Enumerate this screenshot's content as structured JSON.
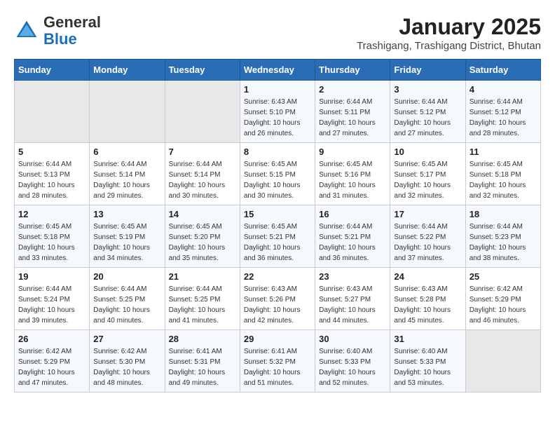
{
  "header": {
    "logo_general": "General",
    "logo_blue": "Blue",
    "month_title": "January 2025",
    "location": "Trashigang, Trashigang District, Bhutan"
  },
  "weekdays": [
    "Sunday",
    "Monday",
    "Tuesday",
    "Wednesday",
    "Thursday",
    "Friday",
    "Saturday"
  ],
  "weeks": [
    [
      {
        "day": "",
        "sunrise": "",
        "sunset": "",
        "daylight": "",
        "empty": true
      },
      {
        "day": "",
        "sunrise": "",
        "sunset": "",
        "daylight": "",
        "empty": true
      },
      {
        "day": "",
        "sunrise": "",
        "sunset": "",
        "daylight": "",
        "empty": true
      },
      {
        "day": "1",
        "sunrise": "Sunrise: 6:43 AM",
        "sunset": "Sunset: 5:10 PM",
        "daylight": "Daylight: 10 hours and 26 minutes.",
        "empty": false
      },
      {
        "day": "2",
        "sunrise": "Sunrise: 6:44 AM",
        "sunset": "Sunset: 5:11 PM",
        "daylight": "Daylight: 10 hours and 27 minutes.",
        "empty": false
      },
      {
        "day": "3",
        "sunrise": "Sunrise: 6:44 AM",
        "sunset": "Sunset: 5:12 PM",
        "daylight": "Daylight: 10 hours and 27 minutes.",
        "empty": false
      },
      {
        "day": "4",
        "sunrise": "Sunrise: 6:44 AM",
        "sunset": "Sunset: 5:12 PM",
        "daylight": "Daylight: 10 hours and 28 minutes.",
        "empty": false
      }
    ],
    [
      {
        "day": "5",
        "sunrise": "Sunrise: 6:44 AM",
        "sunset": "Sunset: 5:13 PM",
        "daylight": "Daylight: 10 hours and 28 minutes.",
        "empty": false
      },
      {
        "day": "6",
        "sunrise": "Sunrise: 6:44 AM",
        "sunset": "Sunset: 5:14 PM",
        "daylight": "Daylight: 10 hours and 29 minutes.",
        "empty": false
      },
      {
        "day": "7",
        "sunrise": "Sunrise: 6:44 AM",
        "sunset": "Sunset: 5:14 PM",
        "daylight": "Daylight: 10 hours and 30 minutes.",
        "empty": false
      },
      {
        "day": "8",
        "sunrise": "Sunrise: 6:45 AM",
        "sunset": "Sunset: 5:15 PM",
        "daylight": "Daylight: 10 hours and 30 minutes.",
        "empty": false
      },
      {
        "day": "9",
        "sunrise": "Sunrise: 6:45 AM",
        "sunset": "Sunset: 5:16 PM",
        "daylight": "Daylight: 10 hours and 31 minutes.",
        "empty": false
      },
      {
        "day": "10",
        "sunrise": "Sunrise: 6:45 AM",
        "sunset": "Sunset: 5:17 PM",
        "daylight": "Daylight: 10 hours and 32 minutes.",
        "empty": false
      },
      {
        "day": "11",
        "sunrise": "Sunrise: 6:45 AM",
        "sunset": "Sunset: 5:18 PM",
        "daylight": "Daylight: 10 hours and 32 minutes.",
        "empty": false
      }
    ],
    [
      {
        "day": "12",
        "sunrise": "Sunrise: 6:45 AM",
        "sunset": "Sunset: 5:18 PM",
        "daylight": "Daylight: 10 hours and 33 minutes.",
        "empty": false
      },
      {
        "day": "13",
        "sunrise": "Sunrise: 6:45 AM",
        "sunset": "Sunset: 5:19 PM",
        "daylight": "Daylight: 10 hours and 34 minutes.",
        "empty": false
      },
      {
        "day": "14",
        "sunrise": "Sunrise: 6:45 AM",
        "sunset": "Sunset: 5:20 PM",
        "daylight": "Daylight: 10 hours and 35 minutes.",
        "empty": false
      },
      {
        "day": "15",
        "sunrise": "Sunrise: 6:45 AM",
        "sunset": "Sunset: 5:21 PM",
        "daylight": "Daylight: 10 hours and 36 minutes.",
        "empty": false
      },
      {
        "day": "16",
        "sunrise": "Sunrise: 6:44 AM",
        "sunset": "Sunset: 5:21 PM",
        "daylight": "Daylight: 10 hours and 36 minutes.",
        "empty": false
      },
      {
        "day": "17",
        "sunrise": "Sunrise: 6:44 AM",
        "sunset": "Sunset: 5:22 PM",
        "daylight": "Daylight: 10 hours and 37 minutes.",
        "empty": false
      },
      {
        "day": "18",
        "sunrise": "Sunrise: 6:44 AM",
        "sunset": "Sunset: 5:23 PM",
        "daylight": "Daylight: 10 hours and 38 minutes.",
        "empty": false
      }
    ],
    [
      {
        "day": "19",
        "sunrise": "Sunrise: 6:44 AM",
        "sunset": "Sunset: 5:24 PM",
        "daylight": "Daylight: 10 hours and 39 minutes.",
        "empty": false
      },
      {
        "day": "20",
        "sunrise": "Sunrise: 6:44 AM",
        "sunset": "Sunset: 5:25 PM",
        "daylight": "Daylight: 10 hours and 40 minutes.",
        "empty": false
      },
      {
        "day": "21",
        "sunrise": "Sunrise: 6:44 AM",
        "sunset": "Sunset: 5:25 PM",
        "daylight": "Daylight: 10 hours and 41 minutes.",
        "empty": false
      },
      {
        "day": "22",
        "sunrise": "Sunrise: 6:43 AM",
        "sunset": "Sunset: 5:26 PM",
        "daylight": "Daylight: 10 hours and 42 minutes.",
        "empty": false
      },
      {
        "day": "23",
        "sunrise": "Sunrise: 6:43 AM",
        "sunset": "Sunset: 5:27 PM",
        "daylight": "Daylight: 10 hours and 44 minutes.",
        "empty": false
      },
      {
        "day": "24",
        "sunrise": "Sunrise: 6:43 AM",
        "sunset": "Sunset: 5:28 PM",
        "daylight": "Daylight: 10 hours and 45 minutes.",
        "empty": false
      },
      {
        "day": "25",
        "sunrise": "Sunrise: 6:42 AM",
        "sunset": "Sunset: 5:29 PM",
        "daylight": "Daylight: 10 hours and 46 minutes.",
        "empty": false
      }
    ],
    [
      {
        "day": "26",
        "sunrise": "Sunrise: 6:42 AM",
        "sunset": "Sunset: 5:29 PM",
        "daylight": "Daylight: 10 hours and 47 minutes.",
        "empty": false
      },
      {
        "day": "27",
        "sunrise": "Sunrise: 6:42 AM",
        "sunset": "Sunset: 5:30 PM",
        "daylight": "Daylight: 10 hours and 48 minutes.",
        "empty": false
      },
      {
        "day": "28",
        "sunrise": "Sunrise: 6:41 AM",
        "sunset": "Sunset: 5:31 PM",
        "daylight": "Daylight: 10 hours and 49 minutes.",
        "empty": false
      },
      {
        "day": "29",
        "sunrise": "Sunrise: 6:41 AM",
        "sunset": "Sunset: 5:32 PM",
        "daylight": "Daylight: 10 hours and 51 minutes.",
        "empty": false
      },
      {
        "day": "30",
        "sunrise": "Sunrise: 6:40 AM",
        "sunset": "Sunset: 5:33 PM",
        "daylight": "Daylight: 10 hours and 52 minutes.",
        "empty": false
      },
      {
        "day": "31",
        "sunrise": "Sunrise: 6:40 AM",
        "sunset": "Sunset: 5:33 PM",
        "daylight": "Daylight: 10 hours and 53 minutes.",
        "empty": false
      },
      {
        "day": "",
        "sunrise": "",
        "sunset": "",
        "daylight": "",
        "empty": true
      }
    ]
  ]
}
